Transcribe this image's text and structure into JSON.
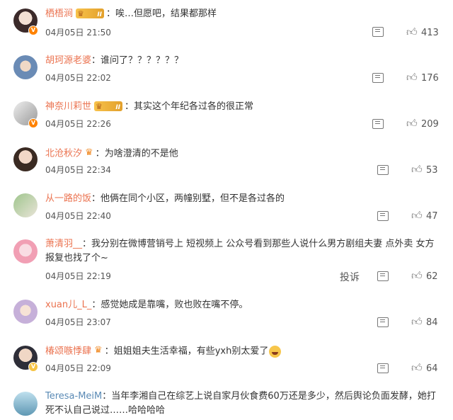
{
  "comments": [
    {
      "user": "栖梧涧",
      "badge": "vip",
      "badge_level": "II",
      "text": "唉…但愿吧，结果都那样",
      "time": "04月05日 21:50",
      "likes": "413"
    },
    {
      "user": "胡珂源老婆",
      "badge": "",
      "text": "谁问了？？？？？？",
      "time": "04月05日 22:02",
      "likes": "176"
    },
    {
      "user": "神奈川莉世",
      "badge": "vip",
      "badge_level": "II",
      "text": "其实这个年纪各过各的很正常",
      "time": "04月05日 22:26",
      "likes": "209"
    },
    {
      "user": "北沧秋汐",
      "badge": "crown",
      "text": "为啥澄清的不是他",
      "time": "04月05日 22:34",
      "likes": "53"
    },
    {
      "user": "从一路的饭",
      "badge": "",
      "text": "他俩在同个小区，两幢别墅，但不是各过各的",
      "time": "04月05日 22:40",
      "likes": "47"
    },
    {
      "user": "萧清羽__",
      "badge": "",
      "text": "我分别在微博营销号上 短视频上 公众号看到那些人说什么男方剧组夫妻 点外卖 女方报复也找了个~",
      "time": "04月05日 22:19",
      "likes": "62",
      "report": "投诉"
    },
    {
      "user": "xuan儿_L_",
      "badge": "",
      "text": "感觉她成是靠嘴，败也败在嘴不停。",
      "time": "04月05日 23:07",
      "likes": "84"
    },
    {
      "user": "椿颂嗾悸肆",
      "badge": "crown",
      "text": "姐姐姐夫生活幸福，有些yxh别太爱了",
      "time": "04月05日 22:09",
      "likes": "64"
    },
    {
      "user": "Teresa-MeiM",
      "badge": "",
      "text": "当年李湘自己在综艺上说自家月伙食费60万还是多少，然后舆论负面发酵，她打死不认自己说过……哈哈哈哈",
      "time": "",
      "likes": ""
    }
  ],
  "separator": "：",
  "icons": {
    "comment": "comment-icon",
    "like": "thumbs-up-icon",
    "verified": "verified-badge-icon",
    "emoji": "laughing-emoji-icon"
  },
  "colors": {
    "username": "#eb7350",
    "verified_orange": "#ff8200",
    "verified_yellow": "#f6c343"
  }
}
